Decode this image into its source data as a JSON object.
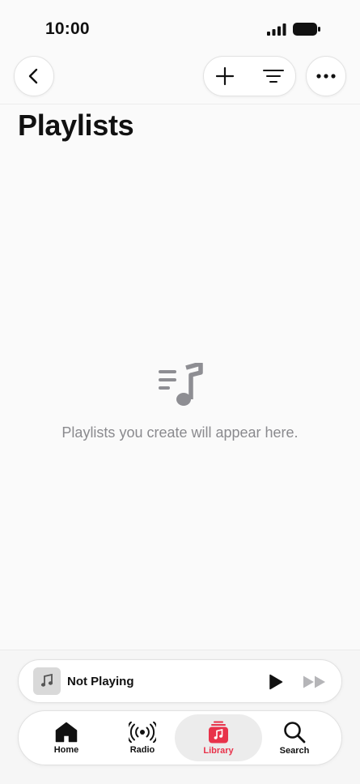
{
  "status_bar": {
    "time": "10:00"
  },
  "nav": {
    "back_icon": "chevron-left-icon",
    "add_icon": "plus-icon",
    "filter_icon": "filter-lines-icon",
    "more_icon": "ellipsis-icon"
  },
  "page": {
    "title": "Playlists",
    "empty_icon": "playlist-note-icon",
    "empty_message": "Playlists you create will appear here."
  },
  "mini_player": {
    "title": "Not Playing",
    "artwork_icon": "music-note-icon",
    "play_icon": "play-icon",
    "forward_icon": "fast-forward-icon"
  },
  "tabs": [
    {
      "label": "Home",
      "icon": "home-icon",
      "selected": false
    },
    {
      "label": "Radio",
      "icon": "radio-waves-icon",
      "selected": false
    },
    {
      "label": "Library",
      "icon": "library-icon",
      "selected": true
    },
    {
      "label": "Search",
      "icon": "magnifier-icon",
      "selected": false
    }
  ],
  "colors": {
    "accent": "#e8324a",
    "background": "#fafafa",
    "muted_text": "#8a8a8e",
    "icon_gray": "#8e8e93"
  }
}
